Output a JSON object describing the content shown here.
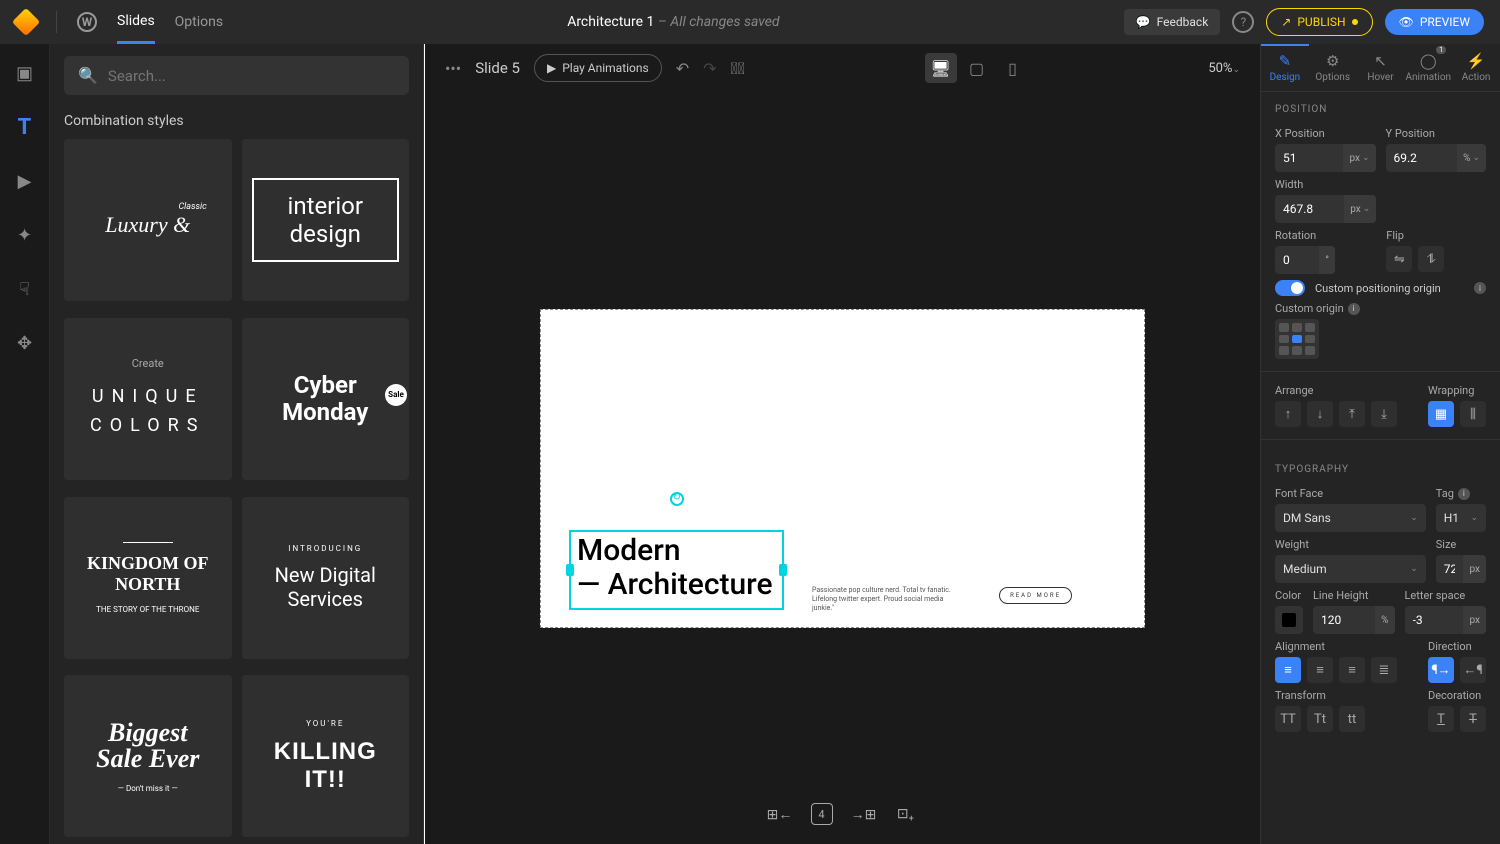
{
  "topbar": {
    "nav": {
      "slides": "Slides",
      "options": "Options"
    },
    "doc_title": "Architecture 1",
    "save_status": "– All changes saved",
    "feedback": "Feedback",
    "publish": "PUBLISH",
    "preview": "PREVIEW"
  },
  "search": {
    "placeholder": "Search..."
  },
  "sidebar": {
    "section_title": "Combination styles",
    "cards": {
      "luxury_top": "Classic",
      "luxury_main": "Luxury &",
      "interior": "interior design",
      "create": "Create",
      "unique": "UNIQUE",
      "colors": "COLORS",
      "cyber": "Cyber Monday",
      "sale_badge": "Sale",
      "kingdom": "KINGDOM OF NORTH",
      "kingdom_tag": "THE STORY OF THE THRONE",
      "intro": "INTRODUCING",
      "digital": "New Digital Services",
      "biggest": "Biggest",
      "saleever": "Sale Ever",
      "dontmiss": "— Don't miss it —",
      "youre": "YOU'RE",
      "killing": "KILLING IT!!"
    }
  },
  "canvas": {
    "slide_label": "Slide 5",
    "play": "Play Animations",
    "zoom": "50%",
    "heading": "Modern\n— Architecture",
    "paragraph": "Passionate pop culture nerd. Total tv fanatic. Lifelong twitter expert. Proud social media junkie.\"",
    "readmore": "READ MORE",
    "slide_count": "4"
  },
  "panel": {
    "tabs": {
      "design": "Design",
      "options": "Options",
      "hover": "Hover",
      "animation": "Animation",
      "action": "Action",
      "anim_badge": "1"
    },
    "position": {
      "title": "POSITION",
      "x_label": "X Position",
      "x_val": "51",
      "x_unit": "px",
      "y_label": "Y Position",
      "y_val": "69.2",
      "y_unit": "%",
      "width_label": "Width",
      "width_val": "467.8",
      "width_unit": "px",
      "rotation_label": "Rotation",
      "rotation_val": "0",
      "rotation_unit": "°",
      "flip_label": "Flip",
      "custom_origin_toggle": "Custom positioning origin",
      "custom_origin_label": "Custom origin",
      "arrange_label": "Arrange",
      "wrapping_label": "Wrapping"
    },
    "typo": {
      "title": "TYPOGRAPHY",
      "font_label": "Font Face",
      "font_val": "DM Sans",
      "tag_label": "Tag",
      "tag_val": "H1",
      "weight_label": "Weight",
      "weight_val": "Medium",
      "size_label": "Size",
      "size_val": "72",
      "size_unit": "px",
      "color_label": "Color",
      "lh_label": "Line Height",
      "lh_val": "120",
      "lh_unit": "%",
      "ls_label": "Letter space",
      "ls_val": "-3",
      "ls_unit": "px",
      "align_label": "Alignment",
      "dir_label": "Direction",
      "transform_label": "Transform",
      "decoration_label": "Decoration"
    }
  }
}
